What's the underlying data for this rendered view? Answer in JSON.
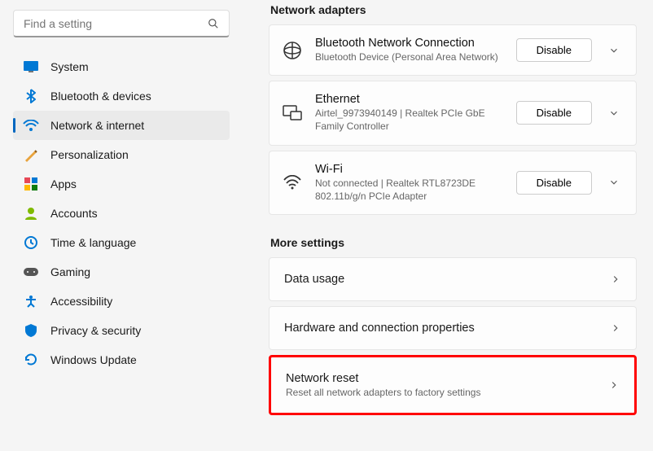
{
  "search": {
    "placeholder": "Find a setting"
  },
  "nav": {
    "items": [
      {
        "key": "system",
        "label": "System"
      },
      {
        "key": "bluetooth",
        "label": "Bluetooth & devices"
      },
      {
        "key": "network",
        "label": "Network & internet"
      },
      {
        "key": "personalization",
        "label": "Personalization"
      },
      {
        "key": "apps",
        "label": "Apps"
      },
      {
        "key": "accounts",
        "label": "Accounts"
      },
      {
        "key": "time",
        "label": "Time & language"
      },
      {
        "key": "gaming",
        "label": "Gaming"
      },
      {
        "key": "accessibility",
        "label": "Accessibility"
      },
      {
        "key": "privacy",
        "label": "Privacy & security"
      },
      {
        "key": "update",
        "label": "Windows Update"
      }
    ],
    "selected": "network"
  },
  "sections": {
    "adapters_heading": "Network adapters",
    "more_heading": "More settings"
  },
  "adapters": [
    {
      "title": "Bluetooth Network Connection",
      "sub": "Bluetooth Device (Personal Area Network)",
      "button": "Disable"
    },
    {
      "title": "Ethernet",
      "sub": "Airtel_9973940149 | Realtek PCIe GbE Family Controller",
      "button": "Disable"
    },
    {
      "title": "Wi-Fi",
      "sub": "Not connected | Realtek RTL8723DE 802.11b/g/n PCIe Adapter",
      "button": "Disable"
    }
  ],
  "more": [
    {
      "title": "Data usage",
      "sub": ""
    },
    {
      "title": "Hardware and connection properties",
      "sub": ""
    },
    {
      "title": "Network reset",
      "sub": "Reset all network adapters to factory settings",
      "highlight": true
    }
  ]
}
